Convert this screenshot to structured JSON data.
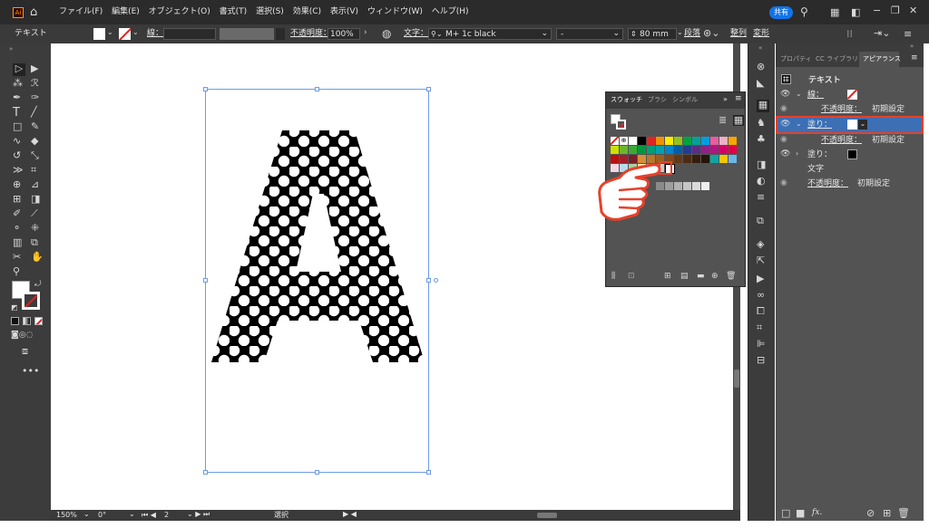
{
  "menubar": {
    "app_badge": "Ai",
    "items": [
      "ファイル(F)",
      "編集(E)",
      "オブジェクト(O)",
      "書式(T)",
      "選択(S)",
      "効果(C)",
      "表示(V)",
      "ウィンドウ(W)",
      "ヘルプ(H)"
    ],
    "share_label": "共有"
  },
  "control_bar": {
    "object_type": "テキスト",
    "stroke_label": "線：",
    "opacity_label": "不透明度：",
    "opacity_value": "100%",
    "character_label": "文字：",
    "font_name": "M+ 1c black",
    "font_style": "-",
    "font_size": "80 mm",
    "paragraph_label": "段落",
    "align_label": "整列",
    "shape_label": "変形"
  },
  "status_bar": {
    "zoom": "150%",
    "rotation": "0°",
    "artboard": "2",
    "tool": "選択"
  },
  "swatches_panel": {
    "tabs": [
      "スウォッチ",
      "ブラシ",
      "シンボル"
    ]
  },
  "right_panel": {
    "tabs": [
      "プロパティ",
      "CC ライブラリ",
      "アピアランス"
    ],
    "object_name": "テキスト",
    "rows": {
      "stroke": "線：",
      "opacity1_label": "不透明度：",
      "opacity1_value": "初期設定",
      "fill1": "塗り：",
      "opacity2_label": "不透明度：",
      "opacity2_value": "初期設定",
      "fill2": "塗り：",
      "characters": "文字",
      "opacity3_label": "不透明度：",
      "opacity3_value": "初期設定"
    },
    "fx_label": "fx."
  },
  "canvas": {
    "letter": "A"
  },
  "colors": {
    "highlight": "#e8402a",
    "selection": "#4b8de8",
    "panel_bg": "#535353",
    "bar_bg": "#323232"
  }
}
